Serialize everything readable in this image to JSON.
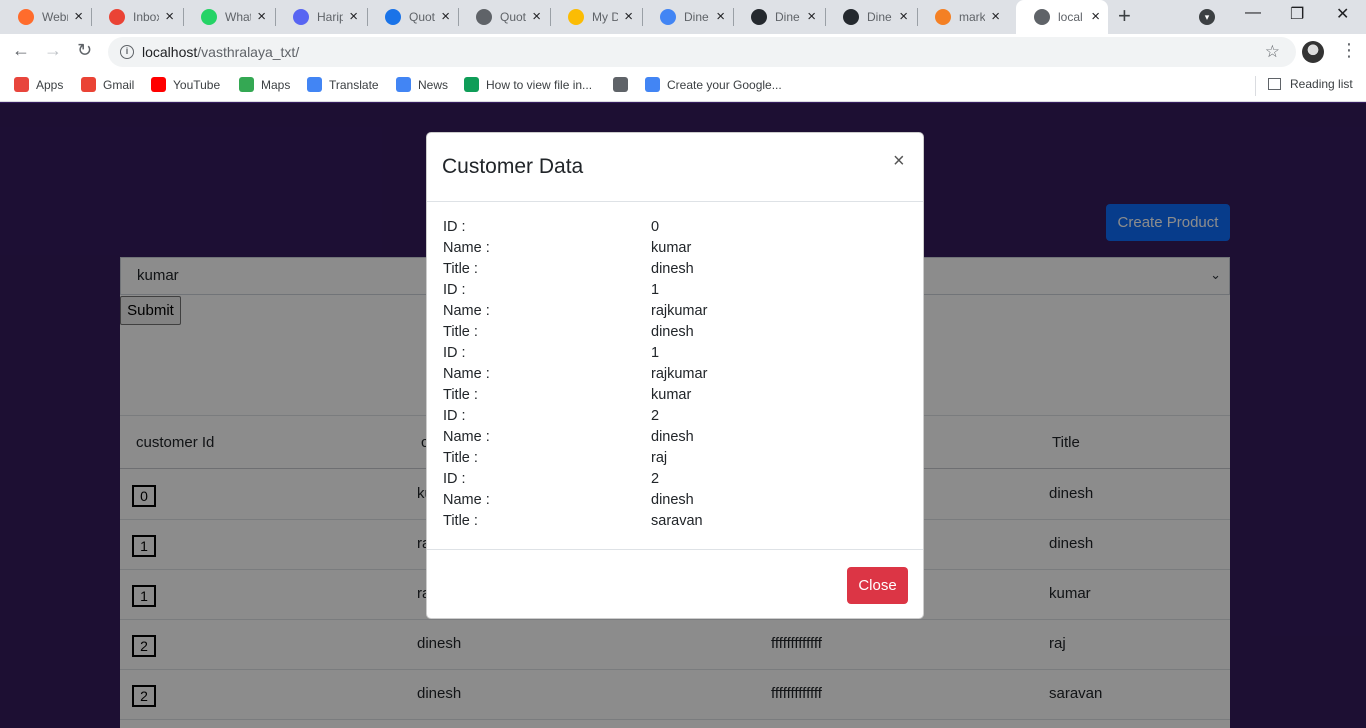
{
  "browser": {
    "tabs": [
      {
        "title": "Webr",
        "icon": "cpanel-icon",
        "color": "#ff6c2c"
      },
      {
        "title": "Inbox",
        "icon": "gmail-icon",
        "color": "#ea4335"
      },
      {
        "title": "What",
        "icon": "whatsapp-icon",
        "color": "#25d366"
      },
      {
        "title": "Harip",
        "icon": "discord-icon",
        "color": "#5865f2"
      },
      {
        "title": "Quot",
        "icon": "home-icon",
        "color": "#1a73e8"
      },
      {
        "title": "Quot",
        "icon": "globe-icon",
        "color": "#5f6368"
      },
      {
        "title": "My D",
        "icon": "drive-icon",
        "color": "#fbbc04"
      },
      {
        "title": "Dine",
        "icon": "docs-icon",
        "color": "#4285f4"
      },
      {
        "title": "Dine",
        "icon": "github-icon",
        "color": "#24292e"
      },
      {
        "title": "Dine",
        "icon": "github-icon",
        "color": "#24292e"
      },
      {
        "title": "mark",
        "icon": "stackoverflow-icon",
        "color": "#f48024"
      },
      {
        "title": "local",
        "icon": "globe-icon",
        "color": "#5f6368"
      }
    ],
    "url_host": "localhost",
    "url_path": "/vasthralaya_txt/",
    "bookmarks": [
      {
        "label": "Apps",
        "icon": "apps-grid-icon",
        "color": "#e8453c"
      },
      {
        "label": "Gmail",
        "icon": "gmail-icon",
        "color": "#ea4335"
      },
      {
        "label": "YouTube",
        "icon": "youtube-icon",
        "color": "#ff0000"
      },
      {
        "label": "Maps",
        "icon": "maps-icon",
        "color": "#34a853"
      },
      {
        "label": "Translate",
        "icon": "translate-icon",
        "color": "#4285f4"
      },
      {
        "label": "News",
        "icon": "news-icon",
        "color": "#4285f4"
      },
      {
        "label": "How to view file in...",
        "icon": "sheets-s-icon",
        "color": "#0f9d58"
      },
      {
        "label": "",
        "icon": "globe-icon",
        "color": "#5f6368"
      },
      {
        "label": "Create your Google...",
        "icon": "google-icon",
        "color": "#4285f4"
      }
    ],
    "reading_list": "Reading list"
  },
  "page": {
    "create_product": "Create Product",
    "select_value": "kumar",
    "submit": "Submit",
    "table": {
      "headers": [
        "customer Id",
        "c",
        "Title"
      ],
      "rows": [
        {
          "id": "0",
          "name": "ku",
          "extra": "",
          "title": "dinesh"
        },
        {
          "id": "1",
          "name": "ra",
          "extra": "",
          "title": "dinesh"
        },
        {
          "id": "1",
          "name": "ra",
          "extra": "",
          "title": "kumar"
        },
        {
          "id": "2",
          "name": "dinesh",
          "extra": "fffffffffffff",
          "title": "raj"
        },
        {
          "id": "2",
          "name": "dinesh",
          "extra": "fffffffffffff",
          "title": "saravan"
        }
      ]
    }
  },
  "modal": {
    "title": "Customer Data",
    "close_x": "×",
    "close_button": "Close",
    "entries": [
      {
        "key": "ID :",
        "value": "0"
      },
      {
        "key": "Name :",
        "value": "kumar"
      },
      {
        "key": "Title :",
        "value": "dinesh"
      },
      {
        "key": "ID :",
        "value": "1"
      },
      {
        "key": "Name :",
        "value": "rajkumar"
      },
      {
        "key": "Title :",
        "value": "dinesh"
      },
      {
        "key": "ID :",
        "value": "1"
      },
      {
        "key": "Name :",
        "value": "rajkumar"
      },
      {
        "key": "Title :",
        "value": "kumar"
      },
      {
        "key": "ID :",
        "value": "2"
      },
      {
        "key": "Name :",
        "value": "dinesh"
      },
      {
        "key": "Title :",
        "value": "raj"
      },
      {
        "key": "ID :",
        "value": "2"
      },
      {
        "key": "Name :",
        "value": "dinesh"
      },
      {
        "key": "Title :",
        "value": "saravan"
      }
    ]
  }
}
